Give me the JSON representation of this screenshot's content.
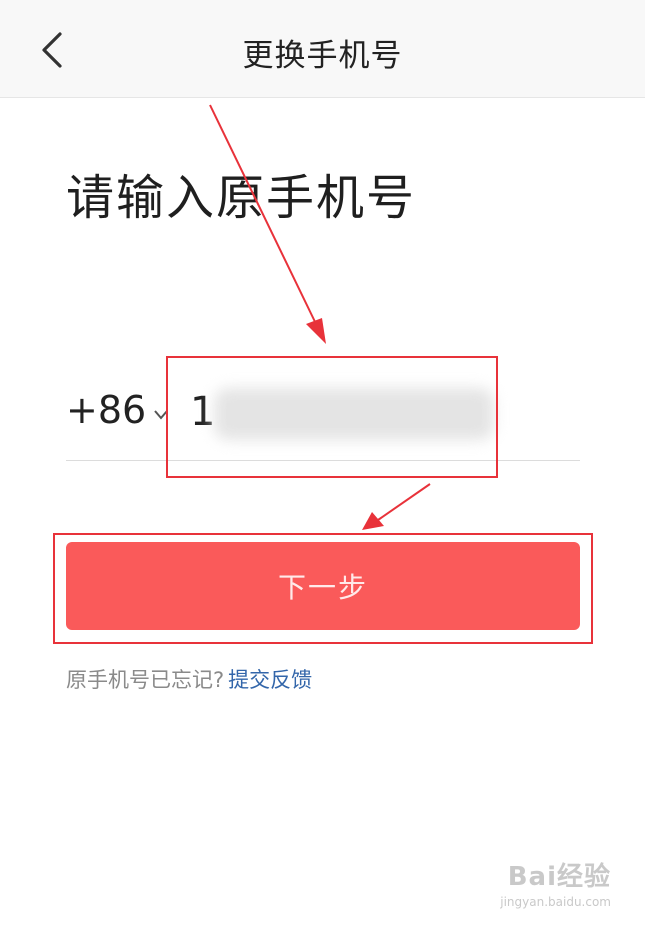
{
  "navbar": {
    "title": "更换手机号",
    "back_icon": "chevron-left-icon"
  },
  "heading": "请输入原手机号",
  "phone": {
    "country_code": "+86",
    "chevron_icon": "chevron-down-icon",
    "value": "1"
  },
  "next_button": {
    "label": "下一步",
    "color": "#fa5a5a"
  },
  "forgot": {
    "text": "原手机号已忘记?",
    "link": "提交反馈",
    "link_color": "#3366aa"
  },
  "annotation_color": "#e8323a",
  "watermark": {
    "brand": "Bai经验",
    "url": "jingyan.baidu.com"
  }
}
